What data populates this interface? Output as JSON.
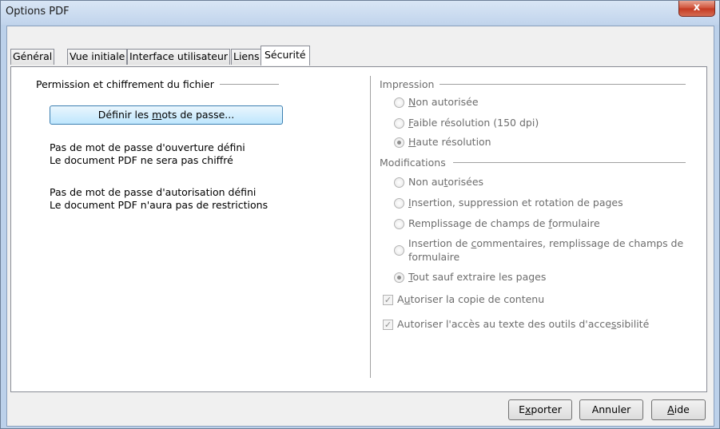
{
  "window": {
    "title": "Options PDF",
    "close_glyph": "x"
  },
  "tabs": [
    {
      "label": "Général"
    },
    {
      "label": "Vue initiale"
    },
    {
      "label": "Interface utilisateur"
    },
    {
      "label": "Liens"
    },
    {
      "label": "Sécurité"
    }
  ],
  "left": {
    "section_title": "Permission et chiffrement du fichier",
    "set_passwords": {
      "pre": "Définir les ",
      "mnemonic": "m",
      "post": "ots de passe..."
    },
    "open_status_1": "Pas de mot de passe d'ouverture défini",
    "open_status_2": "Le document PDF ne sera pas chiffré",
    "perm_status_1": "Pas de mot de passe d'autorisation défini",
    "perm_status_2": "Le document PDF n'aura pas de restrictions"
  },
  "printing": {
    "title": "Impression",
    "options": [
      {
        "pre": "",
        "mnemonic": "N",
        "post": "on autorisée",
        "checked": false
      },
      {
        "pre": "",
        "mnemonic": "F",
        "post": "aible résolution (150 dpi)",
        "checked": false
      },
      {
        "pre": "",
        "mnemonic": "H",
        "post": "aute résolution",
        "checked": true
      }
    ]
  },
  "changes": {
    "title": "Modifications",
    "opt1": {
      "pre": "Non au",
      "mnemonic": "t",
      "post": "orisées",
      "checked": false
    },
    "opt2": {
      "pre": "",
      "mnemonic": "I",
      "post": "nsertion, suppression et rotation de pages",
      "checked": false
    },
    "opt3": {
      "pre": "Remplissage de champs de ",
      "mnemonic": "f",
      "post": "ormulaire",
      "checked": false
    },
    "opt4": {
      "line1_pre": "Insertion de ",
      "line1_mnemonic": "c",
      "line1_post": "ommentaires, remplissage de champs de",
      "line2": "formulaire",
      "checked": false
    },
    "opt5": {
      "pre": "",
      "mnemonic": "T",
      "post": "out sauf extraire les pages",
      "checked": true
    }
  },
  "checkboxes": {
    "copy": {
      "pre": "A",
      "mnemonic": "u",
      "post": "toriser la copie de contenu",
      "checked": true
    },
    "access": {
      "pre": "Autoriser l'accès au texte des outils d'acce",
      "mnemonic": "s",
      "post": "sibilité",
      "checked": true
    }
  },
  "buttons": {
    "export": {
      "pre": "E",
      "mnemonic": "x",
      "post": "porter"
    },
    "cancel": {
      "label": "Annuler"
    },
    "help": {
      "pre": "",
      "mnemonic": "A",
      "post": "ide"
    }
  }
}
